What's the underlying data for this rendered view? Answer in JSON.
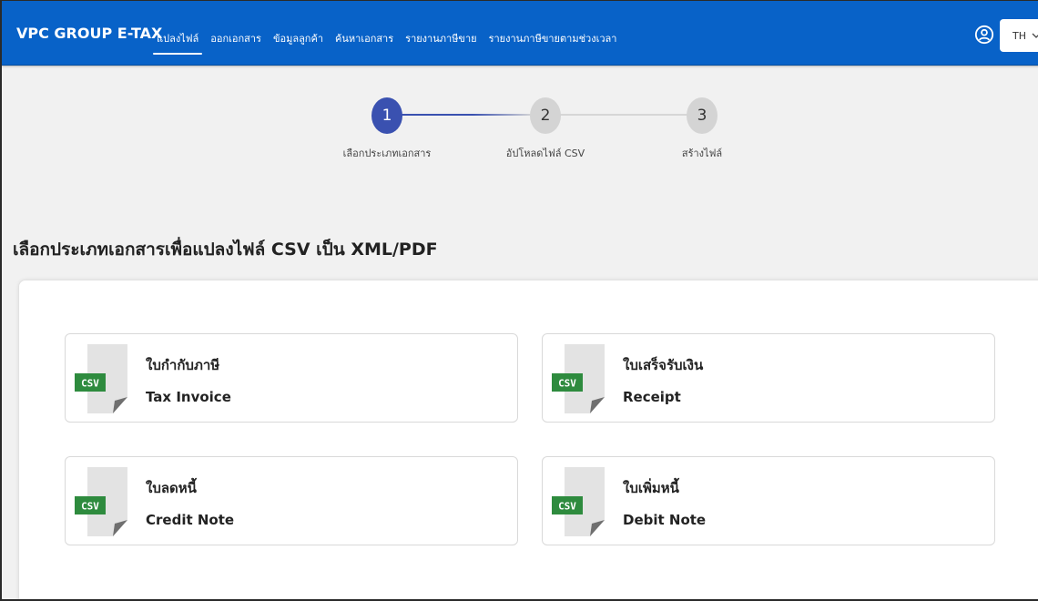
{
  "navbar": {
    "brand": "VPC GROUP E-TAX",
    "items": [
      {
        "label": "แปลงไฟล์",
        "active": true
      },
      {
        "label": "ออกเอกสาร",
        "active": false
      },
      {
        "label": "ข้อมูลลูกค้า",
        "active": false
      },
      {
        "label": "ค้นหาเอกสาร",
        "active": false
      },
      {
        "label": "รายงานภาษีขาย",
        "active": false
      },
      {
        "label": "รายงานภาษีขายตามช่วงเวลา",
        "active": false
      }
    ],
    "user_icon": "user-circle-icon",
    "language": "TH",
    "language_icon": "chevron-down-icon"
  },
  "stepper": {
    "steps": [
      {
        "number": "1",
        "label": "เลือกประเภทเอกสาร",
        "active": true
      },
      {
        "number": "2",
        "label": "อัปโหลดไฟล์ CSV",
        "active": false
      },
      {
        "number": "3",
        "label": "สร้างไฟล์",
        "active": false
      }
    ],
    "active_color": "#3a51b0",
    "inactive_color": "#d4d4d4"
  },
  "page_title": "เลือกประเภทเอกสารเพื่อแปลงไฟล์ CSV เป็น XML/PDF",
  "documents": [
    {
      "title_th": "ใบกำกับภาษี",
      "title_en": "Tax Invoice",
      "badge": "CSV"
    },
    {
      "title_th": "ใบเสร็จรับเงิน",
      "title_en": "Receipt",
      "badge": "CSV"
    },
    {
      "title_th": "ใบลดหนี้",
      "title_en": "Credit Note",
      "badge": "CSV"
    },
    {
      "title_th": "ใบเพิ่มหนี้",
      "title_en": "Debit Note",
      "badge": "CSV"
    }
  ],
  "colors": {
    "navbar": "#0862c8",
    "background": "#f1f1f1",
    "csv_badge": "#2e8b3e"
  }
}
